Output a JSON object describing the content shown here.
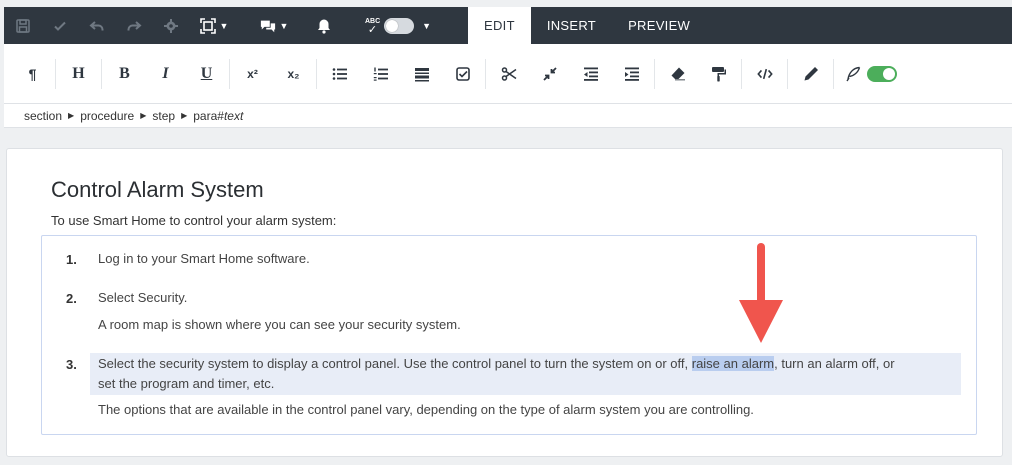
{
  "toolbar": {
    "tabs": [
      {
        "label": "EDIT",
        "active": true
      },
      {
        "label": "INSERT",
        "active": false
      },
      {
        "label": "PREVIEW",
        "active": false
      }
    ],
    "spellcheck_label": "ABC"
  },
  "breadcrumb": {
    "items": [
      "section",
      "procedure",
      "step",
      "para"
    ],
    "suffix_hash": "#",
    "suffix_text": "text"
  },
  "document": {
    "title": "Control Alarm System",
    "intro": "To use Smart Home to control your alarm system:",
    "steps": [
      {
        "number": "1.",
        "text": "Log in to your Smart Home software."
      },
      {
        "number": "2.",
        "text": "Select Security.",
        "note": "A room map is shown where you can see your security system."
      },
      {
        "number": "3.",
        "text_before": "Select the security system to display a control panel. Use the control panel to turn the system on or off, ",
        "selected": "raise an alarm",
        "text_after": ", turn an alarm off, or",
        "text_line2": "set the program and timer, etc.",
        "note": "The options that are available in the control panel vary, depending on the type of alarm system you are controlling."
      }
    ]
  },
  "colors": {
    "toolbar_bg": "#2f3740",
    "selection": "#b9cdef",
    "arrow": "#f0554d",
    "switch_on": "#4cae5b"
  }
}
